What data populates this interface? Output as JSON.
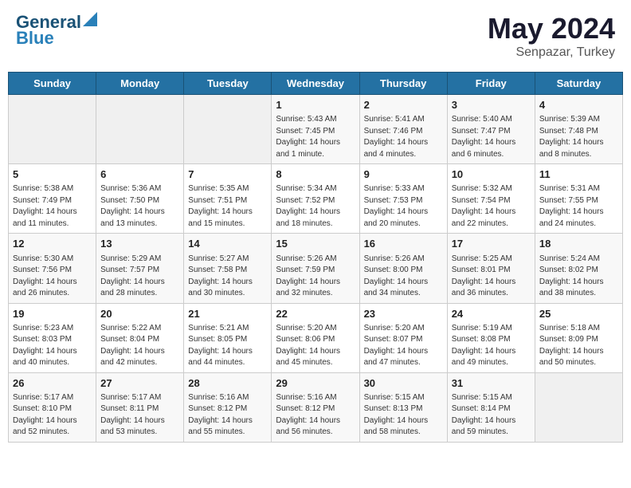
{
  "header": {
    "logo_line1": "General",
    "logo_line2": "Blue",
    "month_year": "May 2024",
    "location": "Senpazar, Turkey"
  },
  "weekdays": [
    "Sunday",
    "Monday",
    "Tuesday",
    "Wednesday",
    "Thursday",
    "Friday",
    "Saturday"
  ],
  "weeks": [
    [
      {
        "day": "",
        "info": ""
      },
      {
        "day": "",
        "info": ""
      },
      {
        "day": "",
        "info": ""
      },
      {
        "day": "1",
        "info": "Sunrise: 5:43 AM\nSunset: 7:45 PM\nDaylight: 14 hours\nand 1 minute."
      },
      {
        "day": "2",
        "info": "Sunrise: 5:41 AM\nSunset: 7:46 PM\nDaylight: 14 hours\nand 4 minutes."
      },
      {
        "day": "3",
        "info": "Sunrise: 5:40 AM\nSunset: 7:47 PM\nDaylight: 14 hours\nand 6 minutes."
      },
      {
        "day": "4",
        "info": "Sunrise: 5:39 AM\nSunset: 7:48 PM\nDaylight: 14 hours\nand 8 minutes."
      }
    ],
    [
      {
        "day": "5",
        "info": "Sunrise: 5:38 AM\nSunset: 7:49 PM\nDaylight: 14 hours\nand 11 minutes."
      },
      {
        "day": "6",
        "info": "Sunrise: 5:36 AM\nSunset: 7:50 PM\nDaylight: 14 hours\nand 13 minutes."
      },
      {
        "day": "7",
        "info": "Sunrise: 5:35 AM\nSunset: 7:51 PM\nDaylight: 14 hours\nand 15 minutes."
      },
      {
        "day": "8",
        "info": "Sunrise: 5:34 AM\nSunset: 7:52 PM\nDaylight: 14 hours\nand 18 minutes."
      },
      {
        "day": "9",
        "info": "Sunrise: 5:33 AM\nSunset: 7:53 PM\nDaylight: 14 hours\nand 20 minutes."
      },
      {
        "day": "10",
        "info": "Sunrise: 5:32 AM\nSunset: 7:54 PM\nDaylight: 14 hours\nand 22 minutes."
      },
      {
        "day": "11",
        "info": "Sunrise: 5:31 AM\nSunset: 7:55 PM\nDaylight: 14 hours\nand 24 minutes."
      }
    ],
    [
      {
        "day": "12",
        "info": "Sunrise: 5:30 AM\nSunset: 7:56 PM\nDaylight: 14 hours\nand 26 minutes."
      },
      {
        "day": "13",
        "info": "Sunrise: 5:29 AM\nSunset: 7:57 PM\nDaylight: 14 hours\nand 28 minutes."
      },
      {
        "day": "14",
        "info": "Sunrise: 5:27 AM\nSunset: 7:58 PM\nDaylight: 14 hours\nand 30 minutes."
      },
      {
        "day": "15",
        "info": "Sunrise: 5:26 AM\nSunset: 7:59 PM\nDaylight: 14 hours\nand 32 minutes."
      },
      {
        "day": "16",
        "info": "Sunrise: 5:26 AM\nSunset: 8:00 PM\nDaylight: 14 hours\nand 34 minutes."
      },
      {
        "day": "17",
        "info": "Sunrise: 5:25 AM\nSunset: 8:01 PM\nDaylight: 14 hours\nand 36 minutes."
      },
      {
        "day": "18",
        "info": "Sunrise: 5:24 AM\nSunset: 8:02 PM\nDaylight: 14 hours\nand 38 minutes."
      }
    ],
    [
      {
        "day": "19",
        "info": "Sunrise: 5:23 AM\nSunset: 8:03 PM\nDaylight: 14 hours\nand 40 minutes."
      },
      {
        "day": "20",
        "info": "Sunrise: 5:22 AM\nSunset: 8:04 PM\nDaylight: 14 hours\nand 42 minutes."
      },
      {
        "day": "21",
        "info": "Sunrise: 5:21 AM\nSunset: 8:05 PM\nDaylight: 14 hours\nand 44 minutes."
      },
      {
        "day": "22",
        "info": "Sunrise: 5:20 AM\nSunset: 8:06 PM\nDaylight: 14 hours\nand 45 minutes."
      },
      {
        "day": "23",
        "info": "Sunrise: 5:20 AM\nSunset: 8:07 PM\nDaylight: 14 hours\nand 47 minutes."
      },
      {
        "day": "24",
        "info": "Sunrise: 5:19 AM\nSunset: 8:08 PM\nDaylight: 14 hours\nand 49 minutes."
      },
      {
        "day": "25",
        "info": "Sunrise: 5:18 AM\nSunset: 8:09 PM\nDaylight: 14 hours\nand 50 minutes."
      }
    ],
    [
      {
        "day": "26",
        "info": "Sunrise: 5:17 AM\nSunset: 8:10 PM\nDaylight: 14 hours\nand 52 minutes."
      },
      {
        "day": "27",
        "info": "Sunrise: 5:17 AM\nSunset: 8:11 PM\nDaylight: 14 hours\nand 53 minutes."
      },
      {
        "day": "28",
        "info": "Sunrise: 5:16 AM\nSunset: 8:12 PM\nDaylight: 14 hours\nand 55 minutes."
      },
      {
        "day": "29",
        "info": "Sunrise: 5:16 AM\nSunset: 8:12 PM\nDaylight: 14 hours\nand 56 minutes."
      },
      {
        "day": "30",
        "info": "Sunrise: 5:15 AM\nSunset: 8:13 PM\nDaylight: 14 hours\nand 58 minutes."
      },
      {
        "day": "31",
        "info": "Sunrise: 5:15 AM\nSunset: 8:14 PM\nDaylight: 14 hours\nand 59 minutes."
      },
      {
        "day": "",
        "info": ""
      }
    ]
  ]
}
